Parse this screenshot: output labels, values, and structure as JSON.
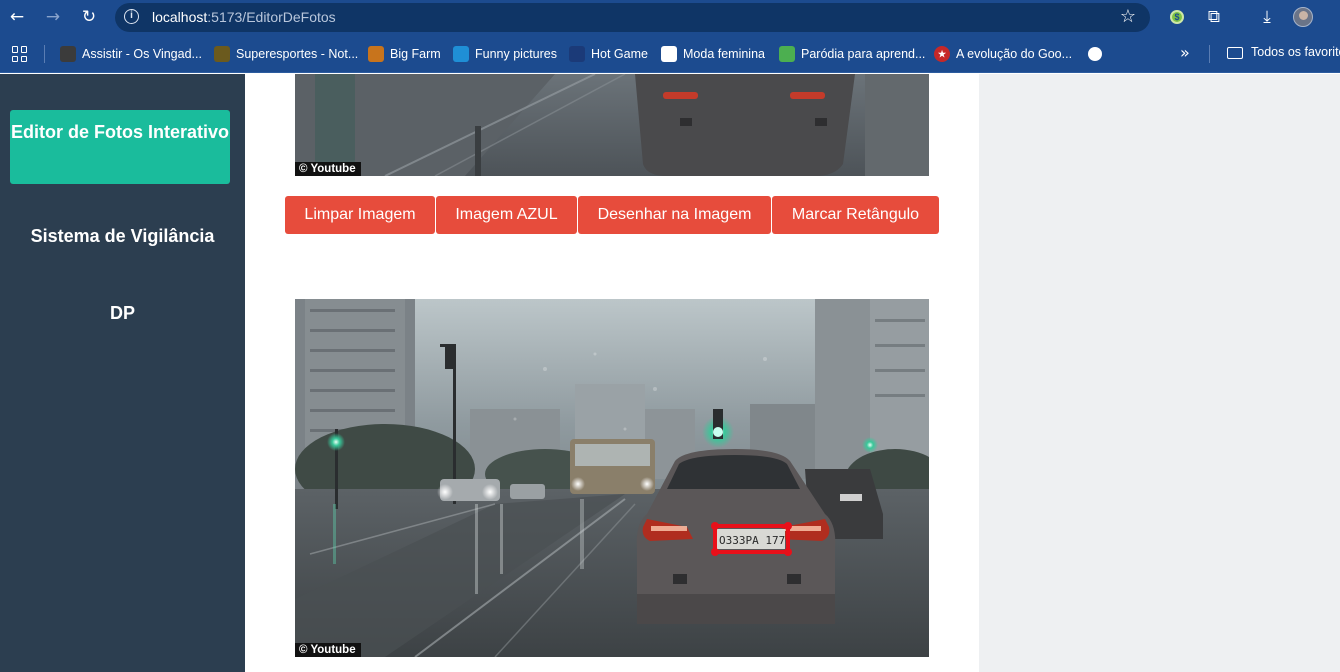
{
  "browser": {
    "url_host": "localhost",
    "url_path": ":5173/EditorDeFotos",
    "bookmarks": [
      {
        "label": "Assistir - Os Vingad...",
        "icon": "movie-icon",
        "color": "#3b3b3b"
      },
      {
        "label": "Superesportes - Not...",
        "icon": "shield-icon",
        "color": "#6b5a1e"
      },
      {
        "label": "Big Farm",
        "icon": "bigfarm-icon",
        "color": "#c8741c"
      },
      {
        "label": "Funny pictures",
        "icon": "funny-icon",
        "color": "#1f8fd6"
      },
      {
        "label": "Hot Game",
        "icon": "hotgame-icon",
        "color": "#1b3a78"
      },
      {
        "label": "Moda feminina",
        "icon": "blank-page-icon",
        "color": "#ffffff"
      },
      {
        "label": "Paródia para aprend...",
        "icon": "play-icon",
        "color": "#4caf50"
      },
      {
        "label": "A evolução do Goo...",
        "icon": "star-badge-icon",
        "color": "#c62828"
      },
      {
        "label": "",
        "icon": "globe-icon",
        "color": "#ffffff"
      }
    ],
    "bookmarks_folder": "Todos os favoritos"
  },
  "sidebar": {
    "brand": "Editor de Fotos Interativo",
    "links": [
      "Sistema de Vigilância",
      "DP"
    ]
  },
  "editor": {
    "photo_credit": "© Youtube",
    "buttons": [
      "Limpar Imagem",
      "Imagem AZUL",
      "Desenhar na Imagem",
      "Marcar Retângulo"
    ],
    "plate_text": "O333PA 177"
  },
  "colors": {
    "chrome": "#1c4b8f",
    "sidebar": "#2c3e50",
    "brand": "#1abc9c",
    "button": "#e74c3c",
    "marker": "#e8101a"
  }
}
